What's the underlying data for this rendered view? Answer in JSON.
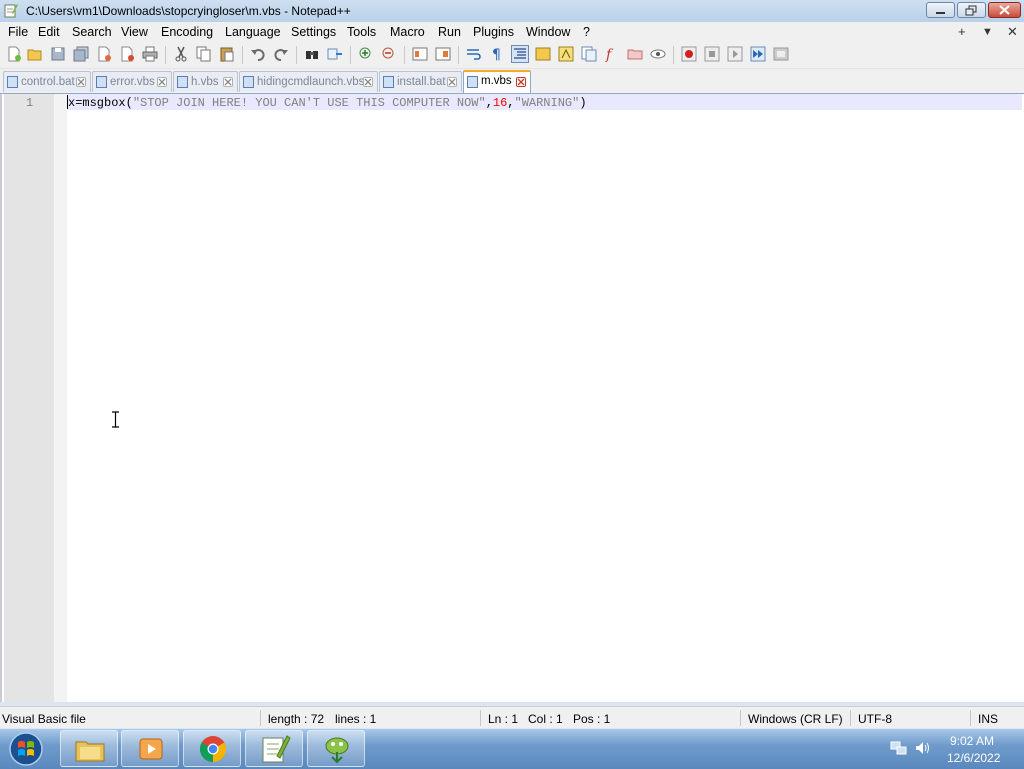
{
  "window": {
    "title": "C:\\Users\\vm1\\Downloads\\stopcryingloser\\m.vbs - Notepad++",
    "icon": "notepad-plus-plus-icon"
  },
  "menu": {
    "items": [
      "File",
      "Edit",
      "Search",
      "View",
      "Encoding",
      "Language",
      "Settings",
      "Tools",
      "Macro",
      "Run",
      "Plugins",
      "Window",
      "?"
    ],
    "right": [
      "+",
      "▼",
      "✕"
    ]
  },
  "tabs": [
    {
      "label": "control.bat",
      "active": false
    },
    {
      "label": "error.vbs",
      "active": false
    },
    {
      "label": "h.vbs",
      "active": false
    },
    {
      "label": "hidingcmdlaunch.vbs",
      "active": false
    },
    {
      "label": "install.bat",
      "active": false
    },
    {
      "label": "m.vbs",
      "active": true
    }
  ],
  "editor": {
    "line_number": "1",
    "code": {
      "var": "x",
      "eq": "=",
      "func": "msgbox",
      "open": "(",
      "str1": "\"STOP JOIN HERE! YOU CAN'T USE THIS COMPUTER NOW\"",
      "comma1": ",",
      "num": "16",
      "comma2": ",",
      "str2": "\"WARNING\"",
      "close": ")"
    }
  },
  "status": {
    "filetype": "Visual Basic file",
    "length": "length : 72",
    "lines": "lines : 1",
    "ln": "Ln : 1",
    "col": "Col : 1",
    "pos": "Pos : 1",
    "eol": "Windows (CR LF)",
    "encoding": "UTF-8",
    "mode": "INS"
  },
  "taskbar": {
    "apps": [
      "file-explorer-icon",
      "media-player-icon",
      "chrome-icon",
      "notepad-plus-plus-icon",
      "installer-icon"
    ],
    "time": "9:02 AM",
    "date": "12/6/2022"
  },
  "colors": {
    "string": "#808080",
    "number": "#ff0000",
    "active_tab_accent": "#f6a828",
    "current_line": "#e8e8ff"
  }
}
